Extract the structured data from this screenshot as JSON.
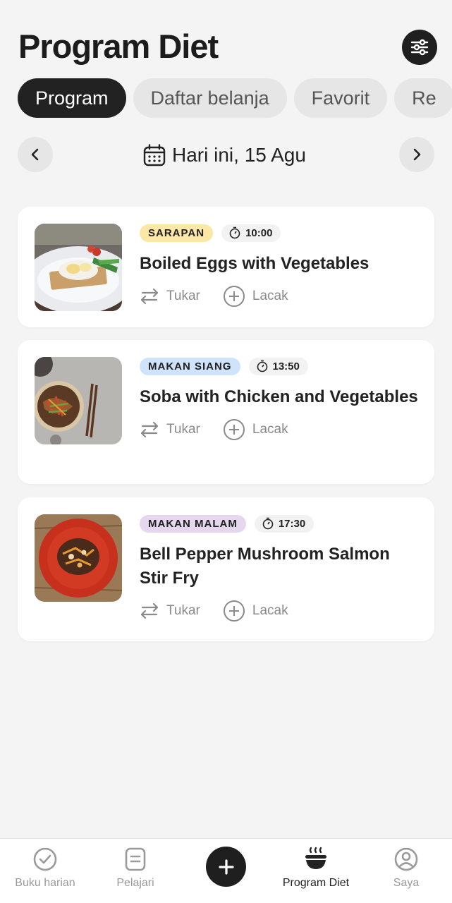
{
  "header": {
    "title": "Program Diet",
    "filter_icon": "sliders-icon"
  },
  "tabs": [
    {
      "label": "Program",
      "active": true
    },
    {
      "label": "Daftar belanja",
      "active": false
    },
    {
      "label": "Favorit",
      "active": false
    },
    {
      "label": "Re",
      "active": false
    }
  ],
  "date_nav": {
    "label": "Hari ini, 15 Agu",
    "prev_icon": "chevron-left-icon",
    "next_icon": "chevron-right-icon",
    "calendar_icon": "calendar-icon"
  },
  "meals": [
    {
      "category": "SARAPAN",
      "category_bg": "#fbe8a6",
      "time": "10:00",
      "name": "Boiled Eggs with Vegetables",
      "swap_label": "Tukar",
      "track_label": "Lacak"
    },
    {
      "category": "MAKAN SIANG",
      "category_bg": "#cfe3fb",
      "time": "13:50",
      "name": "Soba with Chicken and Vegetables",
      "swap_label": "Tukar",
      "track_label": "Lacak"
    },
    {
      "category": "MAKAN MALAM",
      "category_bg": "#e4d7ee",
      "time": "17:30",
      "name": "Bell Pepper Mushroom Salmon Stir Fry",
      "swap_label": "Tukar",
      "track_label": "Lacak"
    }
  ],
  "bottom_nav": [
    {
      "label": "Buku harian",
      "icon": "check-circle-icon"
    },
    {
      "label": "Pelajari",
      "icon": "document-icon"
    },
    {
      "label": "",
      "icon": "plus-icon"
    },
    {
      "label": "Program Diet",
      "icon": "bowl-icon",
      "active": true
    },
    {
      "label": "Saya",
      "icon": "profile-icon"
    }
  ],
  "colors": {
    "accent": "#1f1f1f",
    "background": "#f4f4f4"
  }
}
